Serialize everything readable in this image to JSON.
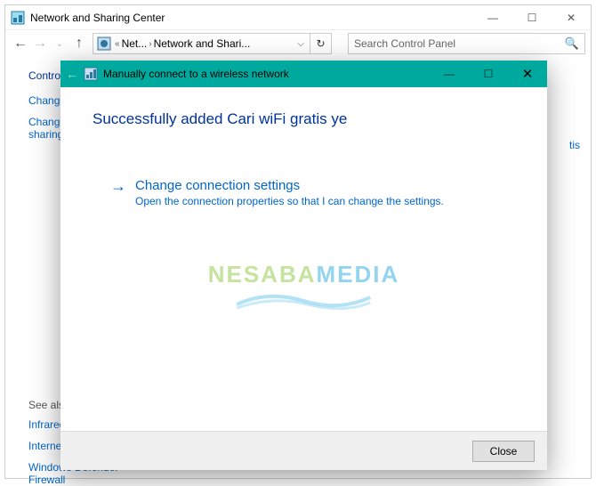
{
  "main_window": {
    "title": "Network and Sharing Center",
    "breadcrumb": {
      "seg1": "Net...",
      "seg2": "Network and Shari..."
    },
    "search_placeholder": "Search Control Panel",
    "left": {
      "heading": "Control Panel Home",
      "link1": "Change adapter settings",
      "link2": "Change advanced sharing settings",
      "seealso_label": "See also",
      "see1": "Infrared",
      "see2": "Internet Options",
      "see3": "Windows Defender Firewall"
    },
    "right_peek": "tis"
  },
  "dialog": {
    "title": "Manually connect to a wireless network",
    "heading": "Successfully added Cari wiFi gratis ye",
    "option_label": "Change connection settings",
    "option_desc": "Open the connection properties so that I can change the settings.",
    "close_label": "Close"
  },
  "watermark": {
    "part1": "NESABA",
    "part2": "MEDIA"
  }
}
